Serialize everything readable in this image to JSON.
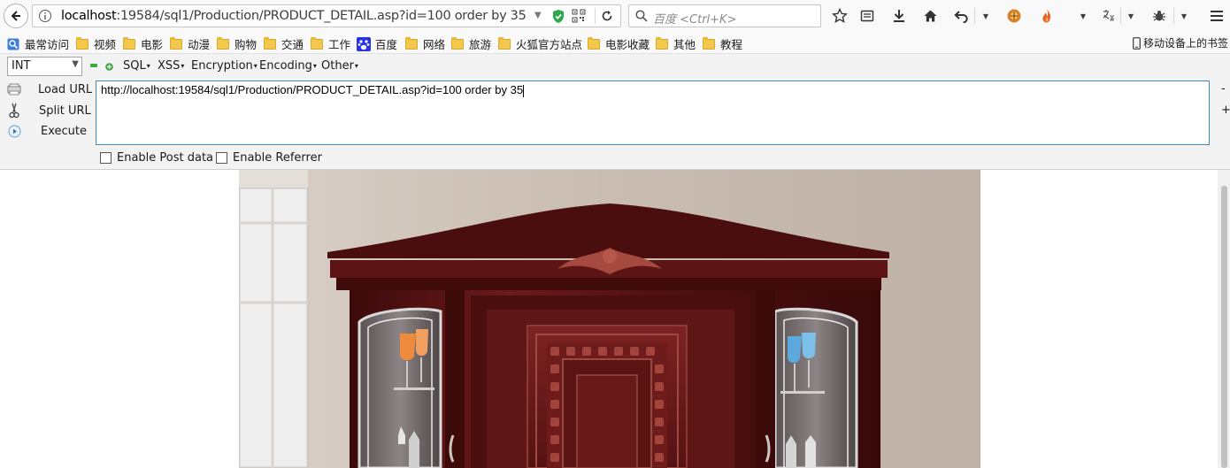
{
  "navbar": {
    "url_host": "localhost",
    "url_rest": ":19584/sql1/Production/PRODUCT_DETAIL.asp?id=100 order by 35",
    "search_placeholder": "百度 <Ctrl+K>"
  },
  "bookmarks": {
    "items": [
      {
        "label": "最常访问",
        "icon": "most-visited-icon"
      },
      {
        "label": "视频",
        "icon": "folder-icon"
      },
      {
        "label": "电影",
        "icon": "folder-icon"
      },
      {
        "label": "动漫",
        "icon": "folder-icon"
      },
      {
        "label": "购物",
        "icon": "folder-icon"
      },
      {
        "label": "交通",
        "icon": "folder-icon"
      },
      {
        "label": "工作",
        "icon": "folder-icon"
      },
      {
        "label": "百度",
        "icon": "baidu-paw-icon"
      },
      {
        "label": "网络",
        "icon": "folder-icon"
      },
      {
        "label": "旅游",
        "icon": "folder-icon"
      },
      {
        "label": "火狐官方站点",
        "icon": "folder-icon"
      },
      {
        "label": "电影收藏",
        "icon": "folder-icon"
      },
      {
        "label": "其他",
        "icon": "folder-icon"
      },
      {
        "label": "教程",
        "icon": "folder-icon"
      }
    ],
    "mobile_label": "移动设备上的书签"
  },
  "hackbar": {
    "select_value": "INT",
    "menus": [
      "SQL",
      "XSS",
      "Encryption",
      "Encoding",
      "Other"
    ],
    "actions": [
      "Load URL",
      "Split URL",
      "Execute"
    ],
    "textarea_value": "http://localhost:19584/sql1/Production/PRODUCT_DETAIL.asp?id=100 order by 35",
    "enable_post": "Enable Post data",
    "enable_referrer": "Enable Referrer",
    "side_minus": "-",
    "side_plus": "+"
  },
  "colors": {
    "toolbar_bg": "#f9f9fa",
    "hackbar_bg": "#f3f3f3",
    "textarea_border": "#3d8bbd",
    "cabinet_wood": "#5a1414"
  }
}
